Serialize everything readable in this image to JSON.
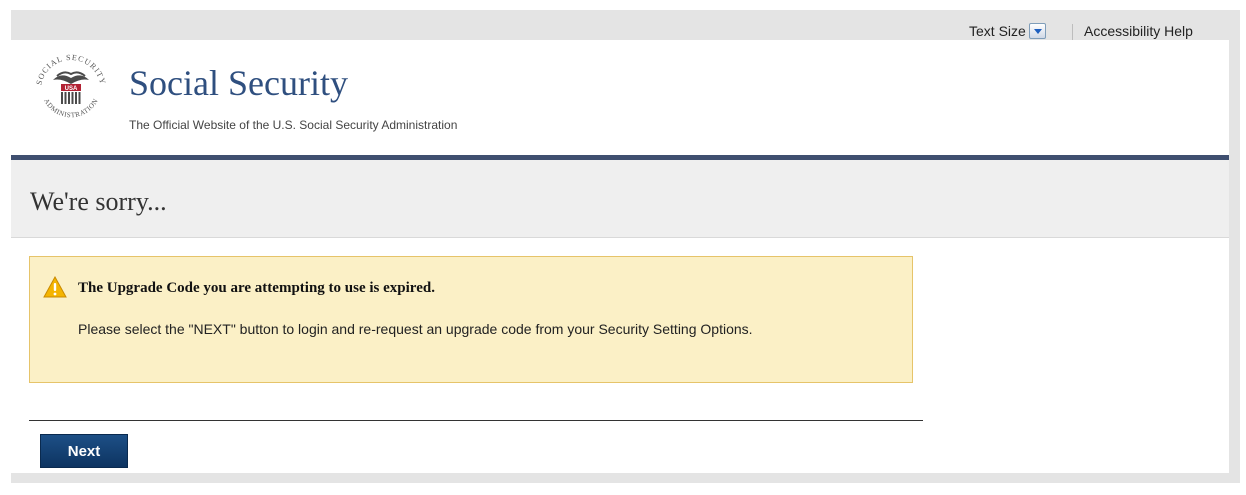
{
  "utility": {
    "text_size_label": "Text Size",
    "accessibility_help": "Accessibility Help"
  },
  "header": {
    "site_title": "Social Security",
    "tagline": "The Official Website of the U.S. Social Security Administration",
    "logo_icon": "ssa-seal-icon",
    "logo_text": "SOCIAL SECURITY ADMINISTRATION USA"
  },
  "page": {
    "title": "We're sorry..."
  },
  "alert": {
    "icon": "warning-icon",
    "heading": "The Upgrade Code you are attempting to use is expired.",
    "body": "Please select the \"NEXT\" button to login and re-request an upgrade code from your Security Setting Options."
  },
  "actions": {
    "next_label": "Next"
  },
  "colors": {
    "brand_blue": "#2f4f7f",
    "header_rule": "#3f4f70",
    "alert_bg": "#fbf0c6",
    "alert_border": "#e6c46a",
    "button_bg": "#0d3461"
  }
}
